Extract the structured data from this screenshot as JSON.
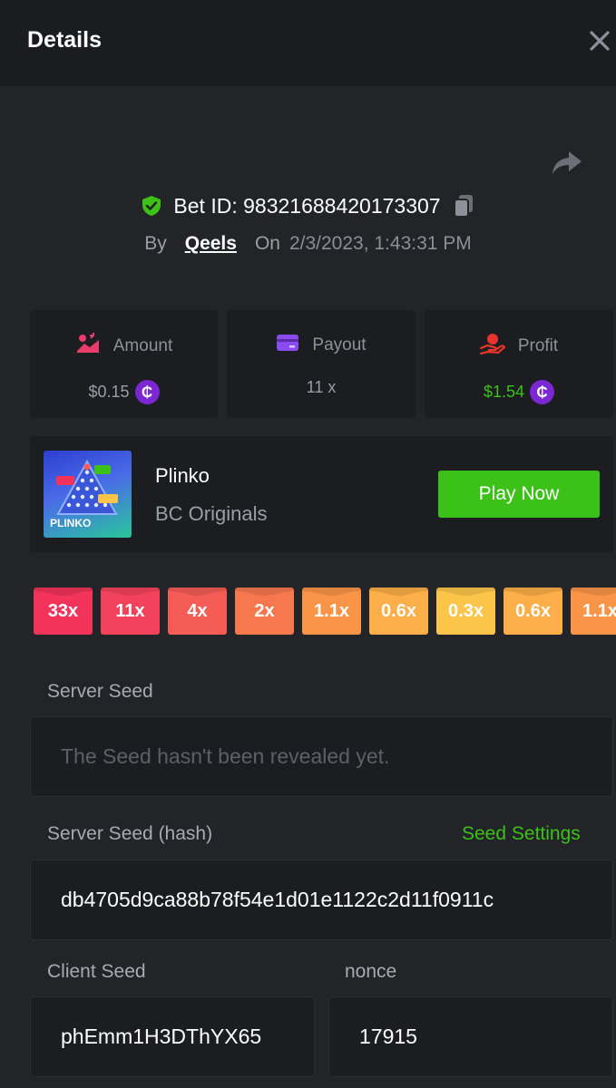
{
  "header": {
    "title": "Details"
  },
  "bet": {
    "id_label": "Bet ID: 98321688420173307",
    "by_label": "By",
    "user": "Qeels",
    "on_label": "On",
    "date": "2/3/2023, 1:43:31 PM"
  },
  "stats": {
    "amount": {
      "label": "Amount",
      "value": "$0.15"
    },
    "payout": {
      "label": "Payout",
      "value": "11 x"
    },
    "profit": {
      "label": "Profit",
      "value": "$1.54"
    },
    "coin_symbol": "₵"
  },
  "game": {
    "name": "Plinko",
    "provider": "BC Originals",
    "thumb_text": "PLINKO",
    "play_label": "Play Now"
  },
  "multipliers": [
    {
      "label": "33x",
      "color": "#f2335a"
    },
    {
      "label": "11x",
      "color": "#f2425c"
    },
    {
      "label": "4x",
      "color": "#f45c55"
    },
    {
      "label": "2x",
      "color": "#f7784d"
    },
    {
      "label": "1.1x",
      "color": "#fa9548"
    },
    {
      "label": "0.6x",
      "color": "#fcae48"
    },
    {
      "label": "0.3x",
      "color": "#fdc44a"
    },
    {
      "label": "0.6x",
      "color": "#fcae48"
    },
    {
      "label": "1.1x",
      "color": "#fa9548"
    }
  ],
  "seeds": {
    "server_seed_label": "Server Seed",
    "server_seed_placeholder": "The Seed hasn't been revealed yet.",
    "hash_label": "Server Seed (hash)",
    "seed_settings_label": "Seed Settings",
    "hash_value": "db4705d9ca88b78f54e1d01e1122c2d11f0911c",
    "client_seed_label": "Client Seed",
    "client_seed_value": "phEmm1H3DThYX65",
    "nonce_label": "nonce",
    "nonce_value": "17915"
  },
  "colors": {
    "accent_green": "#3bc117",
    "coin_purple": "#7b28d3"
  }
}
